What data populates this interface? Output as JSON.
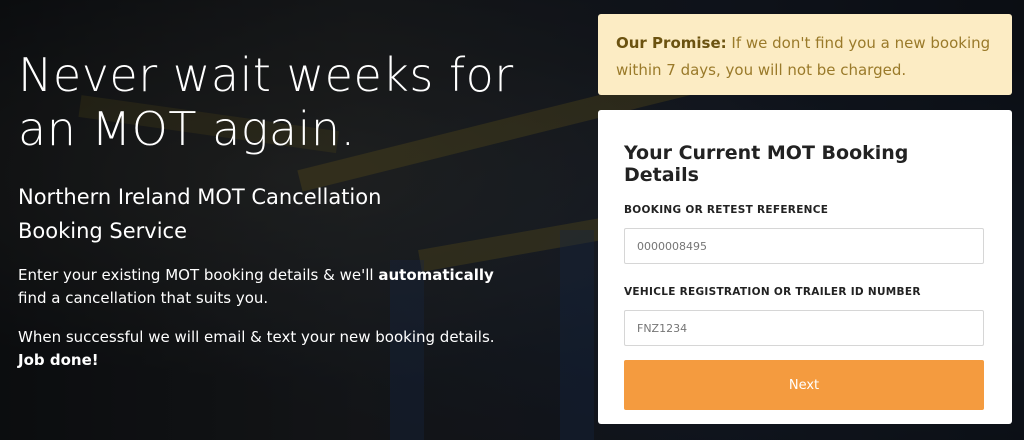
{
  "hero": {
    "headline": "Never wait weeks for an MOT again.",
    "subheadline": "Northern Ireland MOT Cancellation Booking Service",
    "para1_pre": "Enter your existing MOT booking details & we'll ",
    "para1_bold": "automatically",
    "para1_post": " find a cancellation that suits you.",
    "para2_pre": "When successful we will email & text your new booking details. ",
    "para2_bold": "Job done!"
  },
  "promise": {
    "lead": "Our Promise:",
    "text": " If we don't find you a new booking within 7 days, you will not be charged."
  },
  "form": {
    "title": "Your Current MOT Booking Details",
    "booking_label": "BOOKING OR RETEST REFERENCE",
    "booking_placeholder": "0000008495",
    "vehicle_label": "VEHICLE REGISTRATION OR TRAILER ID NUMBER",
    "vehicle_placeholder": "FNZ1234",
    "next_label": "Next"
  },
  "colors": {
    "accent": "#f49b3f",
    "promise_bg": "#fcecc4",
    "promise_text": "#9a7a2a"
  }
}
